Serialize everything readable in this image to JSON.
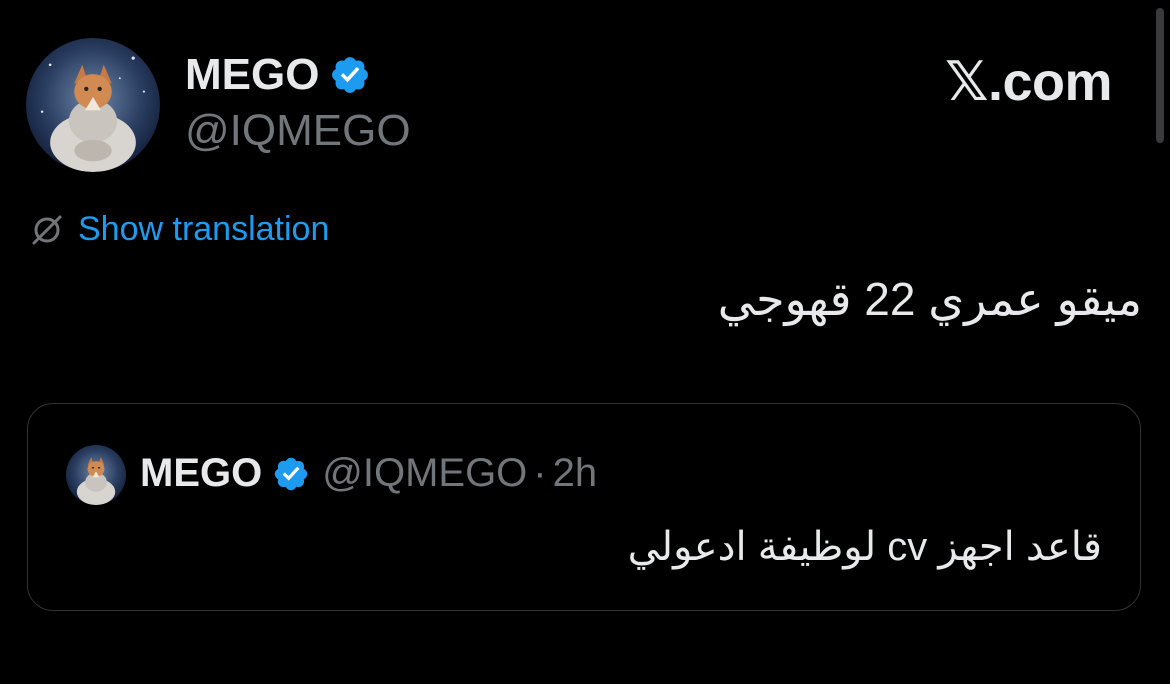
{
  "tweet": {
    "display_name": "MEGO",
    "handle": "@IQMEGO",
    "translate_label": "Show translation",
    "text": "ميقو عمري 22 قهوجي"
  },
  "brand": {
    "label": "𝕏.com"
  },
  "quoted_tweet": {
    "display_name": "MEGO",
    "handle": "@IQMEGO",
    "separator": "·",
    "time": "2h",
    "text": "قاعد اجهز cv لوظيفة ادعولي"
  },
  "icons": {
    "verified": "verified-badge-icon",
    "translate": "translate-globe-slash-icon"
  },
  "colors": {
    "background": "#000000",
    "primary_text": "#e7e9ea",
    "secondary_text": "#71767b",
    "accent": "#1d9bf0",
    "border": "#2f3336"
  }
}
